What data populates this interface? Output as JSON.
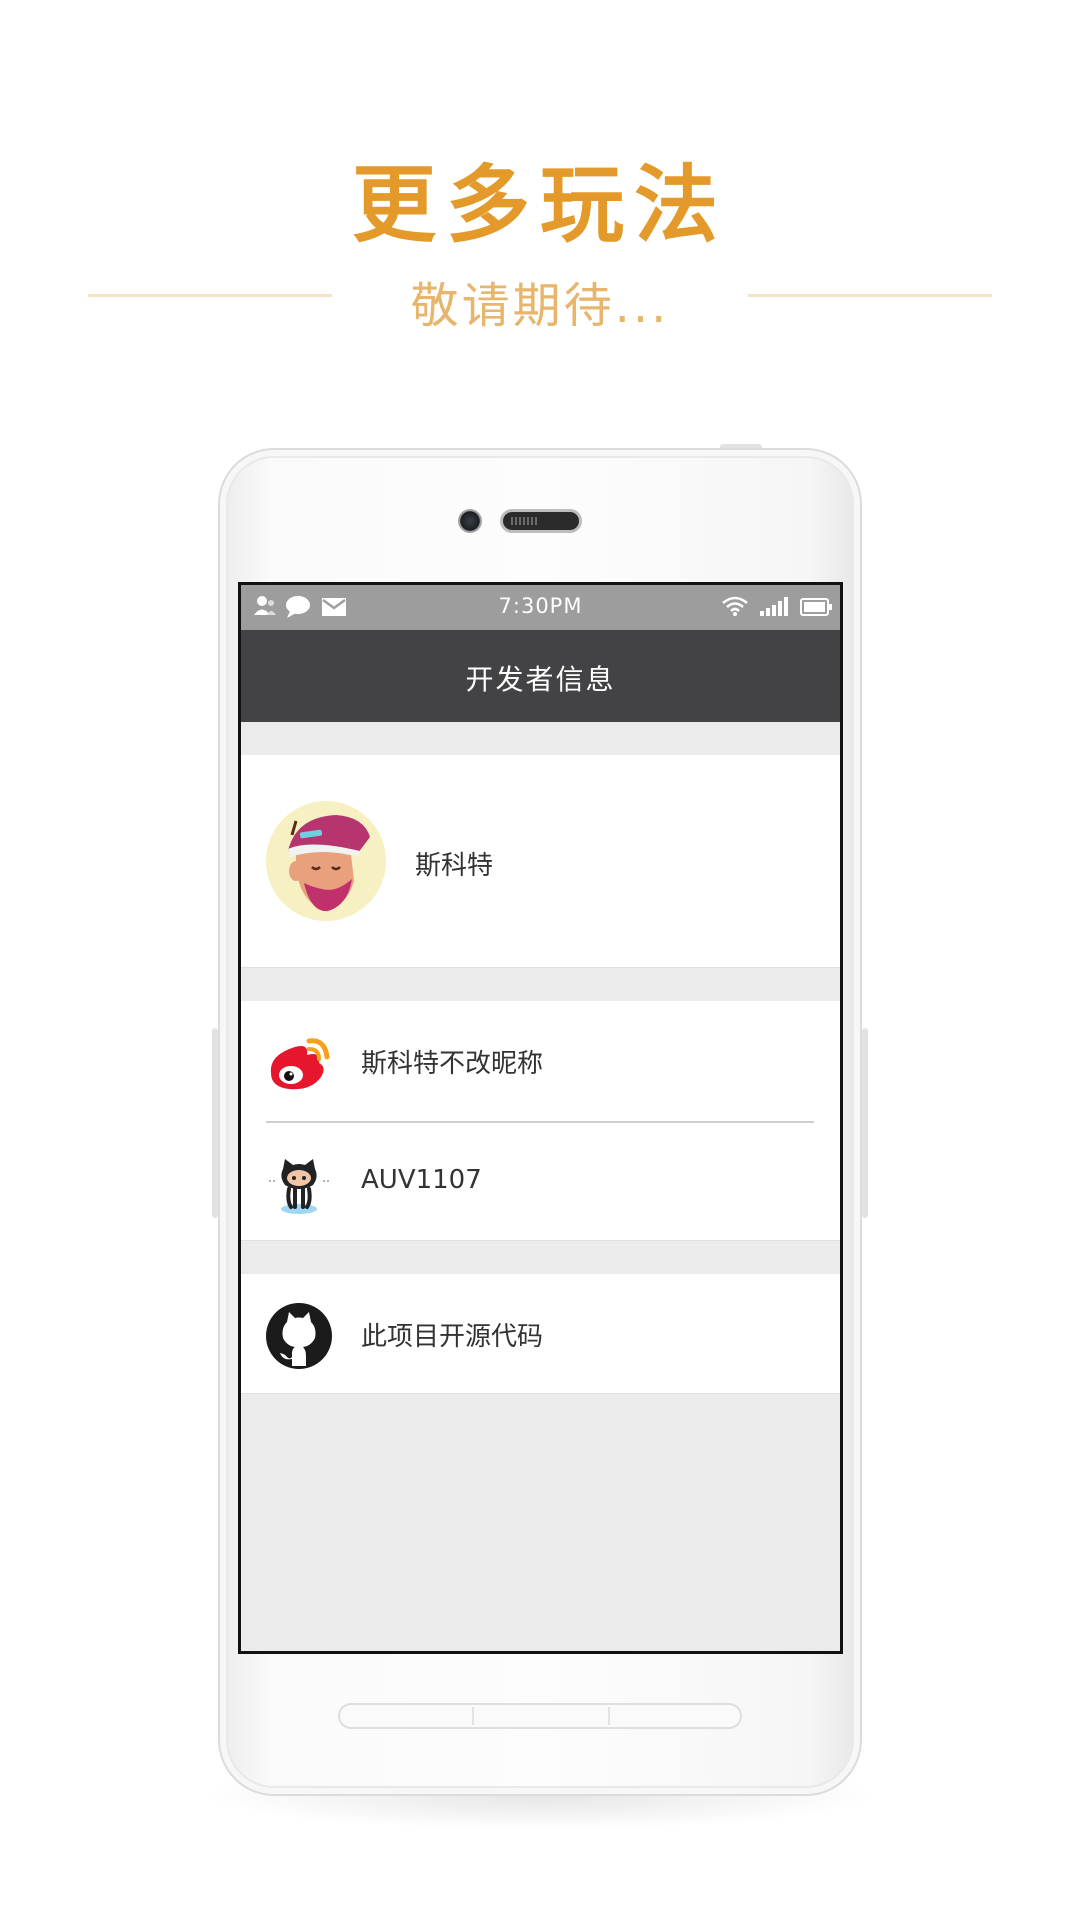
{
  "promo": {
    "title": "更多玩法",
    "subtitle": "敬请期待..."
  },
  "status_bar": {
    "time": "7:30PM",
    "left_icons": [
      "contacts-icon",
      "chat-bubble-icon",
      "mail-icon"
    ],
    "right_icons": [
      "wifi-icon",
      "signal-icon",
      "battery-icon"
    ]
  },
  "app_bar": {
    "title": "开发者信息"
  },
  "profile": {
    "name": "斯科特",
    "avatar": "hipster-avatar"
  },
  "links": [
    {
      "label": "斯科特不改昵称",
      "icon": "weibo-icon"
    },
    {
      "label": "AUV1107",
      "icon": "octocat-icon"
    }
  ],
  "source": {
    "label": "此项目开源代码",
    "icon": "github-icon"
  },
  "colors": {
    "accent": "#e39a2a",
    "subtitle": "#e8b56d",
    "app_bar": "#434244",
    "status_bar": "#9d9d9d",
    "background": "#ebebeb"
  }
}
